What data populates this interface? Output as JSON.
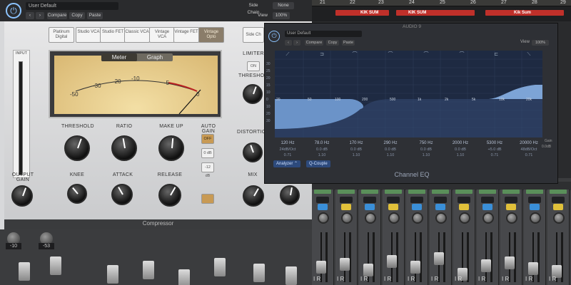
{
  "arrange": {
    "ruler_marks": [
      "21",
      "22",
      "23",
      "24",
      "25",
      "26",
      "27",
      "28",
      "29"
    ],
    "regions": [
      {
        "label": "KIK SUM",
        "color": "#c0302a"
      },
      {
        "label": "KIK SUM",
        "color": "#c0302a"
      },
      {
        "label": "Kik Sum",
        "color": "#c0302a"
      }
    ],
    "side_chain_label": "Side Chain",
    "side_chain_value": "None",
    "view_label": "View",
    "view_value": "100%"
  },
  "compressor": {
    "preset": "User Default",
    "header_buttons": [
      "Compare",
      "Copy",
      "Paste"
    ],
    "models": [
      {
        "label": "Platinum Digital",
        "active": false
      },
      {
        "label": "Studio VCA",
        "active": false
      },
      {
        "label": "Studio FET",
        "active": false
      },
      {
        "label": "Classic VCA",
        "active": false
      },
      {
        "label": "Vintage VCA",
        "active": false
      },
      {
        "label": "Vintage FET",
        "active": false
      },
      {
        "label": "Vintage Opto",
        "active": true
      }
    ],
    "sidechain_btn": "Side Ch",
    "meter_tabs": {
      "meter": "Meter",
      "graph": "Graph",
      "active": "meter"
    },
    "vu_scale": [
      "-50",
      "-30",
      "-20",
      "-10",
      "-5",
      "0"
    ],
    "input_level": "INPUT",
    "output_label": "OUTPUT GAIN",
    "knobs": {
      "threshold": "THRESHOLD",
      "ratio": "RATIO",
      "makeup": "MAKE UP",
      "knee": "KNEE",
      "attack": "ATTACK",
      "release": "RELEASE",
      "distortion": "DISTORTION",
      "mix": "MIX",
      "limiter_threshold": "THRESHOLD"
    },
    "auto_gain": {
      "label": "AUTO GAIN",
      "options": [
        {
          "label": "OFF",
          "active": true
        },
        {
          "label": "0 dB",
          "active": false
        },
        {
          "label": "-12 dB",
          "active": false
        }
      ]
    },
    "limiter": {
      "label": "LIMITER",
      "on_label": "ON"
    },
    "footer": "Compressor"
  },
  "eq": {
    "title": "AUDIO 9",
    "preset": "User Default",
    "header_buttons": [
      "Compare",
      "Copy",
      "Paste"
    ],
    "view_label": "View",
    "view_value": "100%",
    "db_scale": [
      "+",
      "30",
      "25",
      "20",
      "15",
      "10",
      "5",
      "0",
      "5",
      "10",
      "15",
      "20",
      "25",
      "30"
    ],
    "hz_scale": [
      "20",
      "50",
      "100",
      "200",
      "500",
      "1k",
      "2k",
      "5k",
      "10k",
      "20k"
    ],
    "bands": [
      {
        "freq": "120 Hz",
        "gain": "24dB/Oct",
        "q": "0.71"
      },
      {
        "freq": "78.0 Hz",
        "gain": "0.0 dB",
        "q": "1.10"
      },
      {
        "freq": "170 Hz",
        "gain": "0.0 dB",
        "q": "1.10"
      },
      {
        "freq": "290 Hz",
        "gain": "0.0 dB",
        "q": "1.10"
      },
      {
        "freq": "750 Hz",
        "gain": "0.0 dB",
        "q": "1.10"
      },
      {
        "freq": "2000 Hz",
        "gain": "0.0 dB",
        "q": "1.10"
      },
      {
        "freq": "5300 Hz",
        "gain": "+5.0 dB",
        "q": "0.71"
      },
      {
        "freq": "20000 Hz",
        "gain": "48dB/Oct",
        "q": "0.71"
      }
    ],
    "analyzer_btn": "Analyzer",
    "qcouple_btn": "Q-Couple",
    "gain_label": "Gain",
    "gain_value": "0.0dB",
    "footer": "Channel EQ"
  },
  "mixer": {
    "io_label": "I R",
    "left_values": [
      "-10",
      "-53"
    ]
  }
}
